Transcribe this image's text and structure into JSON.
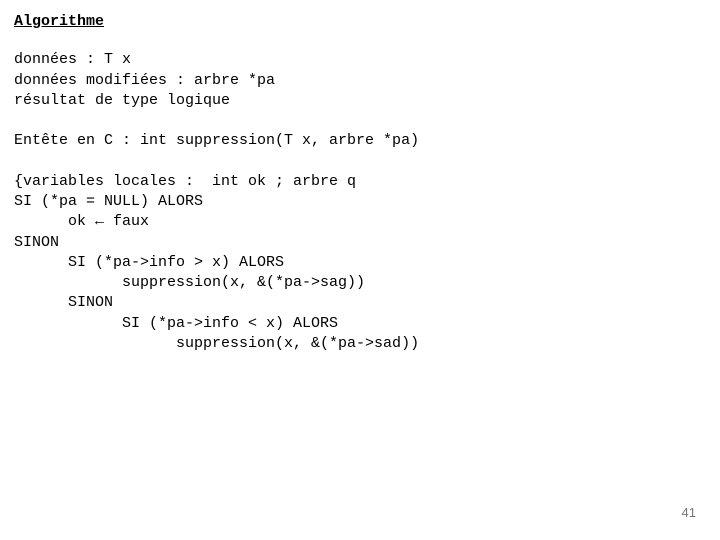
{
  "title": "Algorithme",
  "lines": {
    "l1": "données : T x",
    "l2": "données modifiées : arbre *pa",
    "l3": "résultat de type logique",
    "blank1": "",
    "l4": "Entête en C : int suppression(T x, arbre *pa)",
    "blank2": "",
    "l5": "{variables locales :  int ok ; arbre q",
    "l6": "SI (*pa = NULL) ALORS",
    "l7": "      ok ← faux",
    "l8": "SINON",
    "l9": "      SI (*pa->info > x) ALORS",
    "l10": "            suppression(x, &(*pa->sag))",
    "l11": "      SINON",
    "l12": "            SI (*pa->info < x) ALORS",
    "l13": "                  suppression(x, &(*pa->sad))"
  },
  "page_number": "41"
}
